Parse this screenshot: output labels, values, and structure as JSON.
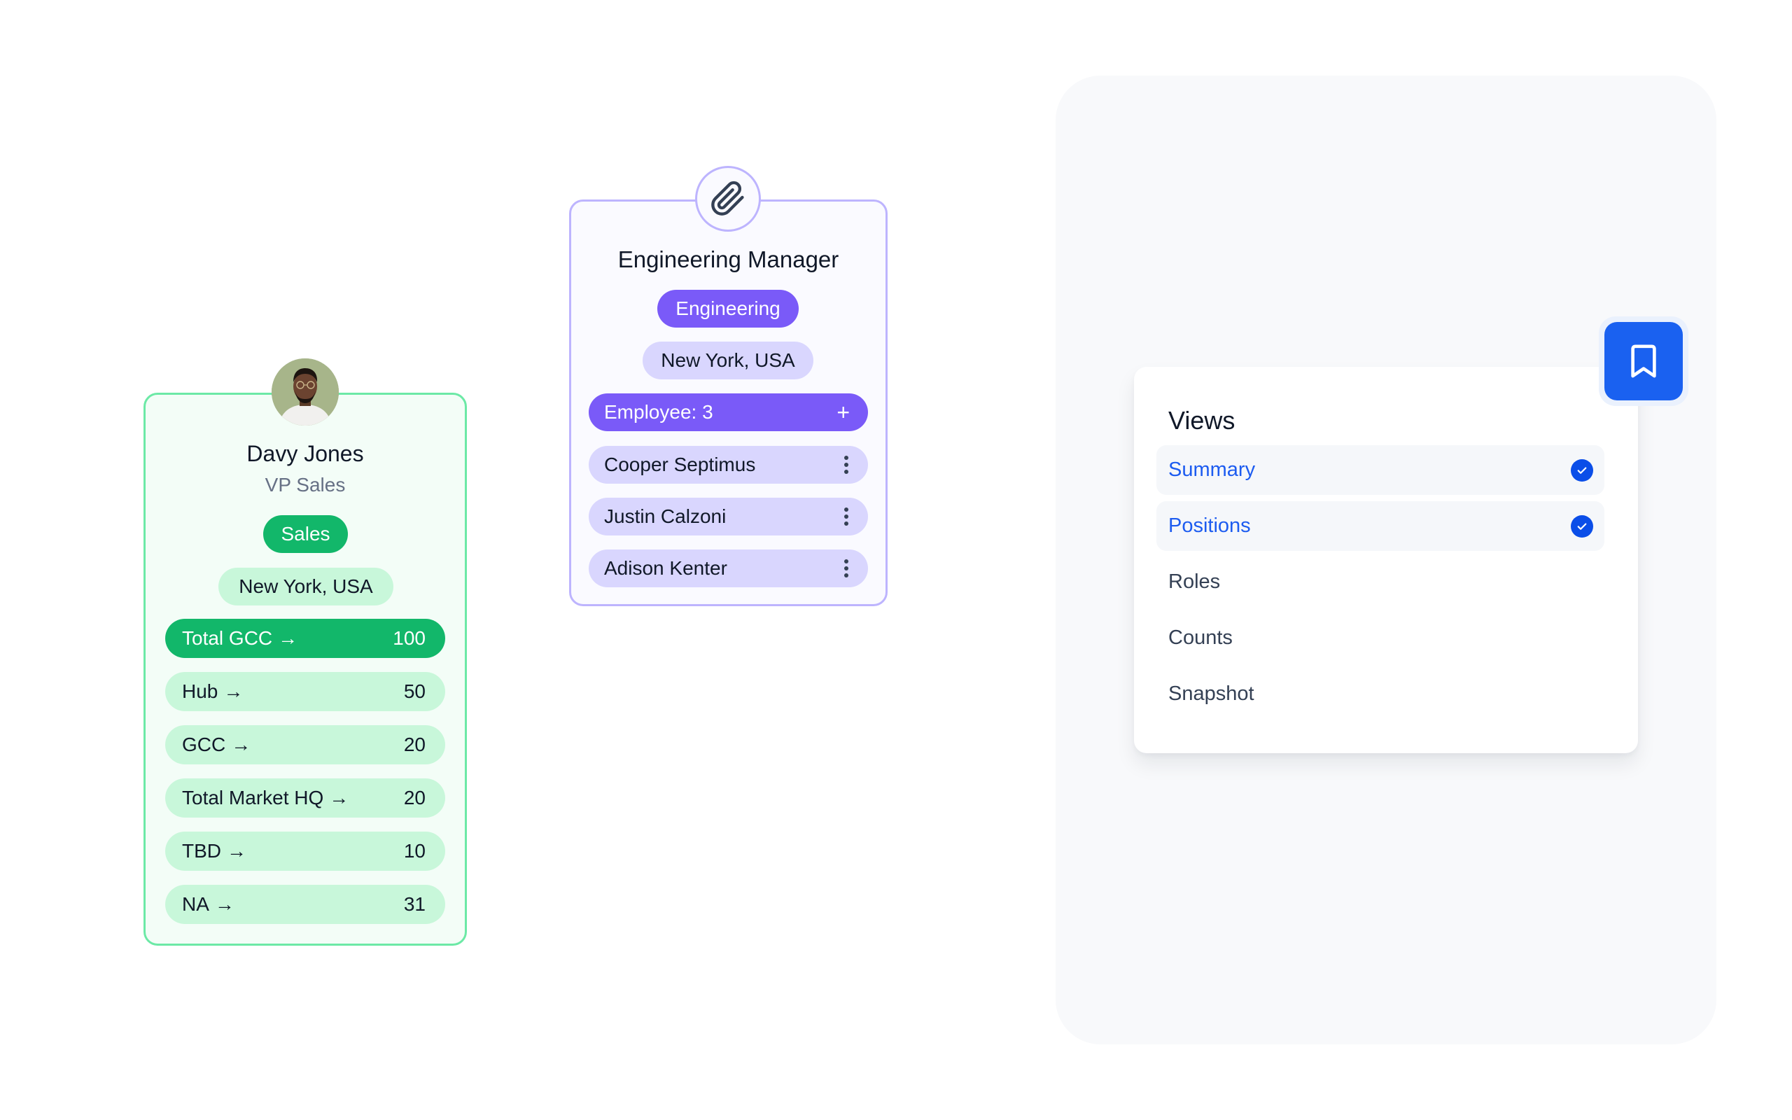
{
  "person_card": {
    "name": "Davy Jones",
    "title": "VP Sales",
    "department": "Sales",
    "location": "New York, USA",
    "stats": [
      {
        "label": "Total GCC",
        "arrow": "→",
        "value": "100",
        "primary": true
      },
      {
        "label": "Hub",
        "arrow": "→",
        "value": "50",
        "primary": false
      },
      {
        "label": "GCC",
        "arrow": "→",
        "value": "20",
        "primary": false
      },
      {
        "label": "Total Market HQ",
        "arrow": "→",
        "value": "20",
        "primary": false
      },
      {
        "label": "TBD",
        "arrow": "→",
        "value": "10",
        "primary": false
      },
      {
        "label": "NA",
        "arrow": "→",
        "value": "31",
        "primary": false
      }
    ],
    "colors": {
      "accent": "#12b76a",
      "light": "#c8f7da",
      "border": "#6ce9a6",
      "background": "#f3fdf7"
    }
  },
  "role_card": {
    "icon": "paperclip-icon",
    "title": "Engineering Manager",
    "department": "Engineering",
    "location": "New York, USA",
    "employee_count_label": "Employee: 3",
    "add_icon": "+",
    "employees": [
      {
        "name": "Cooper Septimus"
      },
      {
        "name": "Justin Calzoni"
      },
      {
        "name": "Adison Kenter"
      }
    ],
    "colors": {
      "accent": "#7a5af8",
      "light": "#d9d6fe",
      "border": "#bdb4fe",
      "background": "#fafaff"
    }
  },
  "views_panel": {
    "title": "Views",
    "bookmark_icon": "bookmark-icon",
    "items": [
      {
        "label": "Summary",
        "selected": true
      },
      {
        "label": "Positions",
        "selected": true
      },
      {
        "label": "Roles",
        "selected": false
      },
      {
        "label": "Counts",
        "selected": false
      },
      {
        "label": "Snapshot",
        "selected": false
      }
    ],
    "colors": {
      "accent": "#1a61f0",
      "selected_text": "#1d5cf0"
    }
  }
}
